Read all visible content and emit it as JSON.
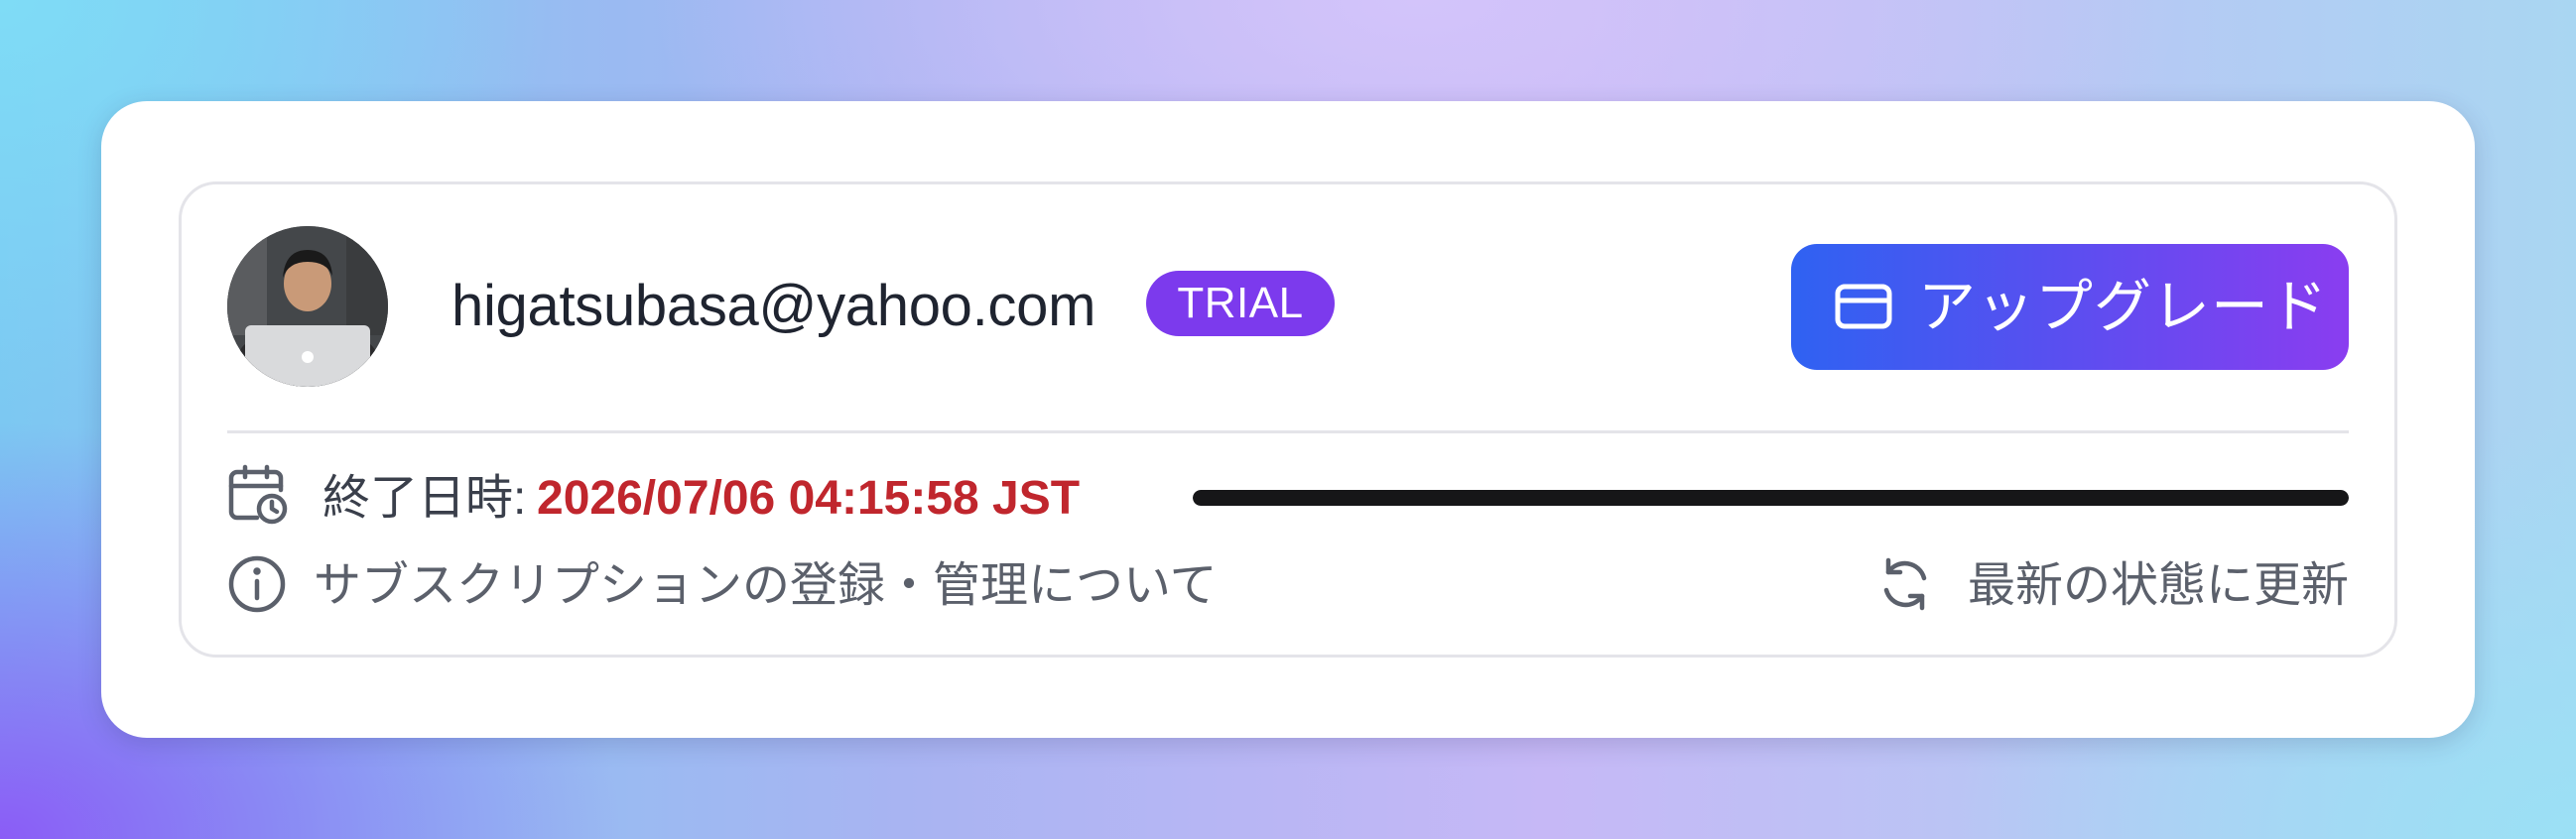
{
  "account": {
    "email": "higatsubasa@yahoo.com",
    "plan_badge": "TRIAL",
    "avatar_alt": "user avatar"
  },
  "actions": {
    "upgrade_label": "アップグレード",
    "upgrade_icon": "credit-card-icon",
    "refresh_label": "最新の状態に更新",
    "refresh_icon": "refresh-icon",
    "info_label": "サブスクリプションの登録・管理について",
    "info_icon": "info-icon"
  },
  "subscription": {
    "end_label": "終了日時:",
    "end_value": "2026/07/06 04:15:58 JST",
    "end_icon": "calendar-clock-icon",
    "remaining_fraction": 1.0
  },
  "colors": {
    "badge": "#7c3aed",
    "button_gradient_start": "#2f62f2",
    "button_gradient_end": "#8a3df0",
    "end_value": "#c0262d"
  }
}
